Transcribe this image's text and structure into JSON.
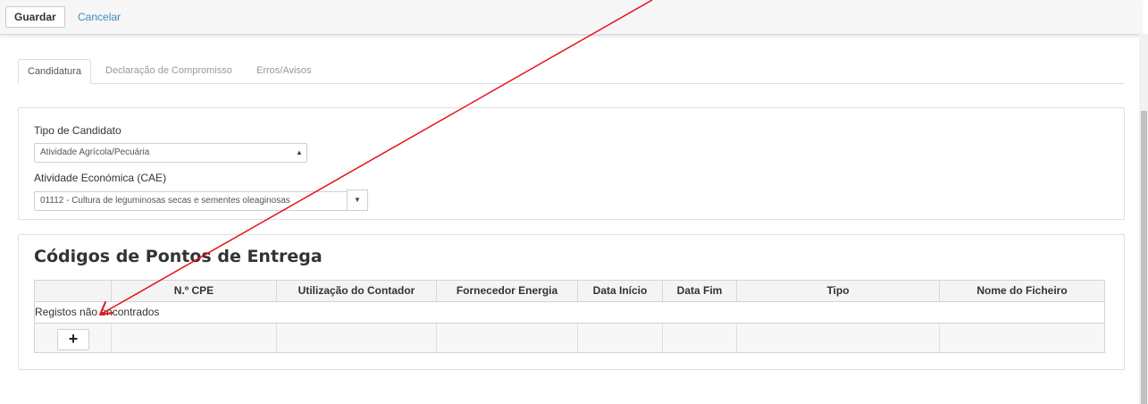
{
  "toolbar": {
    "save_label": "Guardar",
    "cancel_label": "Cancelar"
  },
  "tabs": [
    {
      "label": "Candidatura",
      "active": true
    },
    {
      "label": "Declaração de Compromisso",
      "active": false
    },
    {
      "label": "Erros/Avisos",
      "active": false
    }
  ],
  "form": {
    "candidate_type_label": "Tipo de Candidato",
    "candidate_type_value": "Atividade Agrícola/Pecuária",
    "cae_label": "Atividade Económica (CAE)",
    "cae_value": "01112 - Cultura de leguminosas secas e sementes oleaginosas"
  },
  "section": {
    "title": "Códigos de Pontos de Entrega"
  },
  "table": {
    "columns": [
      "",
      "N.º CPE",
      "Utilização do Contador",
      "Fornecedor Energia",
      "Data Início",
      "Data Fim",
      "Tipo",
      "Nome do Ficheiro"
    ],
    "empty_message": "Registos não encontrados",
    "add_icon": "plus-icon"
  },
  "annotation": {
    "color": "#e8121b",
    "icon": "red-arrow"
  },
  "colors": {
    "link": "#3c8dbc",
    "annotation": "#e8121b"
  }
}
